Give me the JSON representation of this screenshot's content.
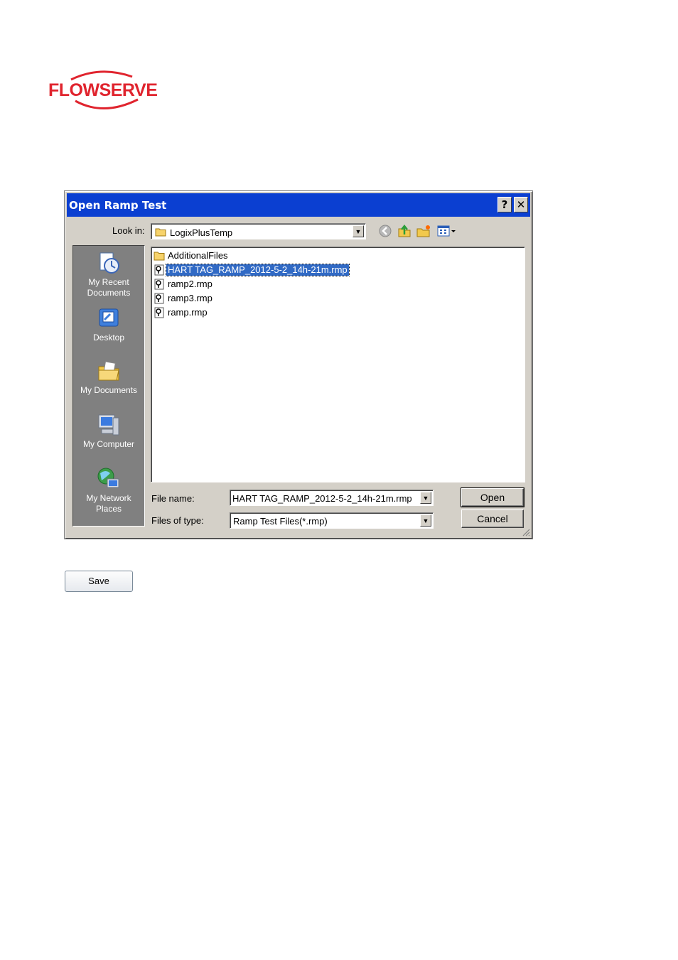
{
  "logo": {
    "text": "FLOWSERVE",
    "color": "#e0242e"
  },
  "dialog": {
    "title": "Open Ramp Test",
    "help_glyph": "?",
    "close_glyph": "✕",
    "look_in_label": "Look in:",
    "look_in_value": "LogixPlusTemp",
    "toolbar_icons": [
      "back-icon",
      "up-folder-icon",
      "new-folder-icon",
      "views-menu-icon"
    ],
    "places": [
      {
        "label": "My Recent Documents",
        "icon": "recent-documents-icon"
      },
      {
        "label": "Desktop",
        "icon": "desktop-icon"
      },
      {
        "label": "My Documents",
        "icon": "my-documents-icon"
      },
      {
        "label": "My Computer",
        "icon": "my-computer-icon"
      },
      {
        "label": "My Network Places",
        "icon": "network-places-icon"
      }
    ],
    "files": [
      {
        "name": "AdditionalFiles",
        "type": "folder",
        "selected": false
      },
      {
        "name": "HART TAG_RAMP_2012-5-2_14h-21m.rmp",
        "type": "rmp",
        "selected": true
      },
      {
        "name": "ramp2.rmp",
        "type": "rmp",
        "selected": false
      },
      {
        "name": "ramp3.rmp",
        "type": "rmp",
        "selected": false
      },
      {
        "name": "ramp.rmp",
        "type": "rmp",
        "selected": false
      }
    ],
    "file_name_label": "File name:",
    "file_name_value": "HART TAG_RAMP_2012-5-2_14h-21m.rmp",
    "files_of_type_label": "Files of type:",
    "files_of_type_value": "Ramp Test Files(*.rmp)",
    "open_label": "Open",
    "cancel_label": "Cancel",
    "selection_color": "#316ac5",
    "titlebar_color": "#0b3fd1"
  },
  "save_label": "Save"
}
